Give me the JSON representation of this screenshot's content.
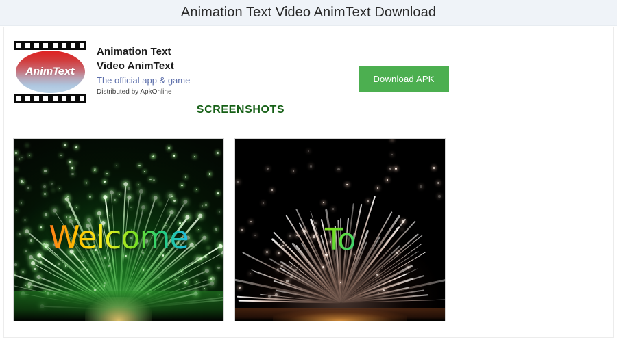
{
  "header": {
    "title": "Animation Text Video AnimText Download",
    "bg_color": "#eff3f8"
  },
  "app": {
    "icon_label": "AnimText",
    "icon_name": "film-strip-animtext-icon",
    "title_line1": "Animation Text",
    "title_line2": "Video AnimText",
    "subtitle": "The official app & game",
    "subtitle_color": "#5d6fab",
    "distributed_by": "Distributed by ApkOnline",
    "download_label": "Download APK",
    "download_color": "#4caf50"
  },
  "screenshots": {
    "heading": "SCREENSHOTS",
    "heading_color": "#166016",
    "items": [
      {
        "caption_text": "Welcome",
        "background": "green fireworks night sky with water reflection",
        "bg_color": "#030803",
        "text_style": "rainbow gradient"
      },
      {
        "caption_text": "To",
        "background": "white radial firework burst on black sky",
        "bg_color": "#000000",
        "text_style": "yellow to green to blue gradient"
      }
    ]
  }
}
